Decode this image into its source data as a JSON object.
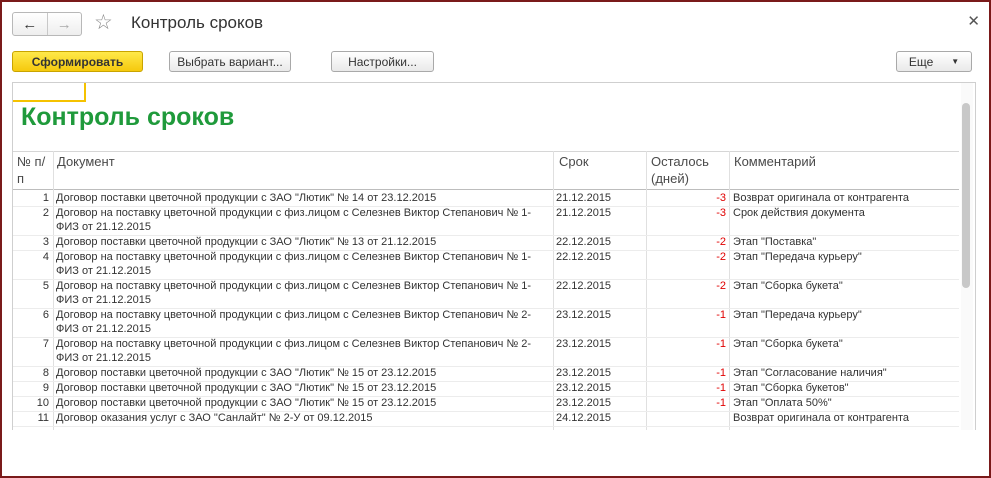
{
  "window": {
    "title": "Контроль сроков",
    "back_icon": "arrow-left-icon",
    "forward_icon": "arrow-right-icon",
    "favorite_icon": "star-icon",
    "close_icon": "close-icon"
  },
  "toolbar": {
    "generate_label": "Сформировать",
    "choose_variant_label": "Выбрать вариант...",
    "settings_label": "Настройки...",
    "more_label": "Еще"
  },
  "report": {
    "title": "Контроль сроков",
    "columns": {
      "num": "№ п/п",
      "doc": "Документ",
      "date": "Срок",
      "left": "Осталось (дней)",
      "comment": "Комментарий"
    },
    "rows": [
      {
        "num": "1",
        "doc": "Договор поставки цветочной продукции с ЗАО \"Лютик\" № 14 от 23.12.2015",
        "date": "21.12.2015",
        "left": "-3",
        "comment": "Возврат оригинала от контрагента"
      },
      {
        "num": "2",
        "doc": "Договор на поставку цветочной продукции с физ.лицом с Селезнев Виктор Степанович № 1-ФИЗ от 21.12.2015",
        "date": "21.12.2015",
        "left": "-3",
        "comment": "Срок действия документа"
      },
      {
        "num": "3",
        "doc": "Договор поставки цветочной продукции с ЗАО \"Лютик\" № 13 от 21.12.2015",
        "date": "22.12.2015",
        "left": "-2",
        "comment": "Этап \"Поставка\""
      },
      {
        "num": "4",
        "doc": "Договор на поставку цветочной продукции с физ.лицом с Селезнев Виктор Степанович № 1-ФИЗ от 21.12.2015",
        "date": "22.12.2015",
        "left": "-2",
        "comment": "Этап \"Передача курьеру\""
      },
      {
        "num": "5",
        "doc": "Договор на поставку цветочной продукции с физ.лицом с Селезнев Виктор Степанович № 1-ФИЗ от 21.12.2015",
        "date": "22.12.2015",
        "left": "-2",
        "comment": "Этап \"Сборка букета\""
      },
      {
        "num": "6",
        "doc": "Договор на поставку цветочной продукции с физ.лицом с Селезнев Виктор Степанович № 2-ФИЗ от 21.12.2015",
        "date": "23.12.2015",
        "left": "-1",
        "comment": "Этап \"Передача курьеру\""
      },
      {
        "num": "7",
        "doc": "Договор на поставку цветочной продукции с физ.лицом с Селезнев Виктор Степанович № 2-ФИЗ от 21.12.2015",
        "date": "23.12.2015",
        "left": "-1",
        "comment": "Этап \"Сборка букета\""
      },
      {
        "num": "8",
        "doc": "Договор поставки цветочной продукции с ЗАО \"Лютик\" № 15 от 23.12.2015",
        "date": "23.12.2015",
        "left": "-1",
        "comment": "Этап \"Согласование наличия\""
      },
      {
        "num": "9",
        "doc": "Договор поставки цветочной продукции с ЗАО \"Лютик\" № 15 от 23.12.2015",
        "date": "23.12.2015",
        "left": "-1",
        "comment": "Этап \"Сборка букетов\""
      },
      {
        "num": "10",
        "doc": "Договор поставки цветочной продукции с ЗАО \"Лютик\" № 15 от 23.12.2015",
        "date": "23.12.2015",
        "left": "-1",
        "comment": "Этап \"Оплата 50%\""
      },
      {
        "num": "11",
        "doc": "Договор оказания услуг с ЗАО \"Санлайт\" № 2-У от 09.12.2015",
        "date": "24.12.2015",
        "left": "",
        "comment": "Возврат оригинала от контрагента"
      }
    ]
  },
  "colors": {
    "title_green": "#1f9a3b",
    "negative_red": "#e00000",
    "primary_yellow": "#f5c90d",
    "frame": "#7a1a1a"
  }
}
